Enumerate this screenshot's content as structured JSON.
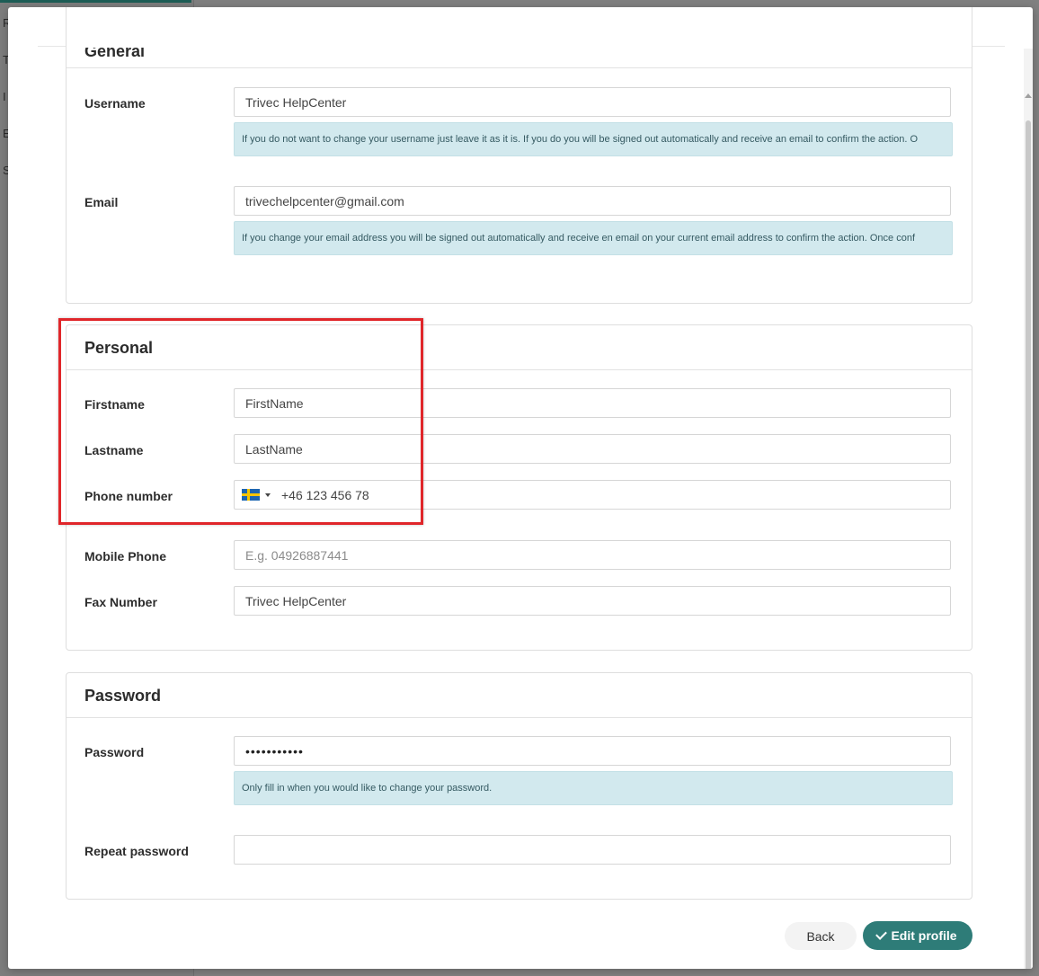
{
  "background": {
    "sidebar_letters": [
      "R",
      "T",
      "I",
      "E",
      "S"
    ]
  },
  "general": {
    "title": "General",
    "username_label": "Username",
    "username_value": "Trivec HelpCenter",
    "username_help": "If you do not want to change your username just leave it as it is. If you do you will be signed out automatically and receive an email to confirm the action. O",
    "email_label": "Email",
    "email_value": "trivechelpcenter@gmail.com",
    "email_help": "If you change your email address you will be signed out automatically and receive en email on your current email address to confirm the action. Once conf"
  },
  "personal": {
    "title": "Personal",
    "firstname_label": "Firstname",
    "firstname_value": "FirstName",
    "lastname_label": "Lastname",
    "lastname_value": "LastName",
    "phone_label": "Phone number",
    "phone_value": "+46 123 456 78",
    "mobile_label": "Mobile Phone",
    "mobile_placeholder": "E.g. 04926887441",
    "fax_label": "Fax Number",
    "fax_value": "Trivec HelpCenter"
  },
  "password": {
    "title": "Password",
    "password_label": "Password",
    "password_value": "•••••••••••",
    "password_help": "Only fill in when you would like to change your password.",
    "repeat_label": "Repeat password",
    "repeat_value": ""
  },
  "buttons": {
    "back": "Back",
    "edit_profile": "Edit profile"
  },
  "colors": {
    "accent": "#2e7c78",
    "help_bg": "#d2e9ee",
    "highlight": "#e0262a"
  }
}
